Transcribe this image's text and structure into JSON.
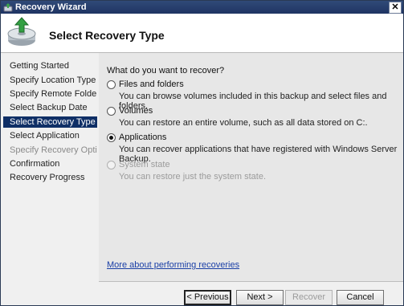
{
  "window": {
    "title": "Recovery Wizard",
    "close_glyph": "✕"
  },
  "header": {
    "title": "Select Recovery Type",
    "icon": "backup-restore-icon"
  },
  "nav": {
    "items": [
      {
        "label": "Getting Started",
        "state": "normal"
      },
      {
        "label": "Specify Location Type",
        "state": "normal"
      },
      {
        "label": "Specify Remote Folder",
        "state": "normal"
      },
      {
        "label": "Select Backup Date",
        "state": "normal"
      },
      {
        "label": "Select Recovery Type",
        "state": "active"
      },
      {
        "label": "Select Application",
        "state": "normal"
      },
      {
        "label": "Specify Recovery Opti...",
        "state": "disabled"
      },
      {
        "label": "Confirmation",
        "state": "normal"
      },
      {
        "label": "Recovery Progress",
        "state": "normal"
      }
    ]
  },
  "content": {
    "question": "What do you want to recover?",
    "options": [
      {
        "label": "Files and folders",
        "desc": "You can browse volumes included in this backup and select files and folders.",
        "checked": false,
        "enabled": true
      },
      {
        "label": "Volumes",
        "desc": "You can restore an entire volume, such as all data stored on C:.",
        "checked": false,
        "enabled": true
      },
      {
        "label": "Applications",
        "desc": "You can recover applications that have registered with Windows Server Backup.",
        "checked": true,
        "enabled": true
      },
      {
        "label": "System state",
        "desc": "You can restore just the system state.",
        "checked": false,
        "enabled": false
      }
    ],
    "link": "More about performing recoveries"
  },
  "footer": {
    "previous": "< Previous",
    "next": "Next >",
    "recover": "Recover",
    "cancel": "Cancel"
  },
  "colors": {
    "nav_active_bg": "#0f2f66",
    "link": "#1a3fa6",
    "titlebar": "#1f3463"
  }
}
